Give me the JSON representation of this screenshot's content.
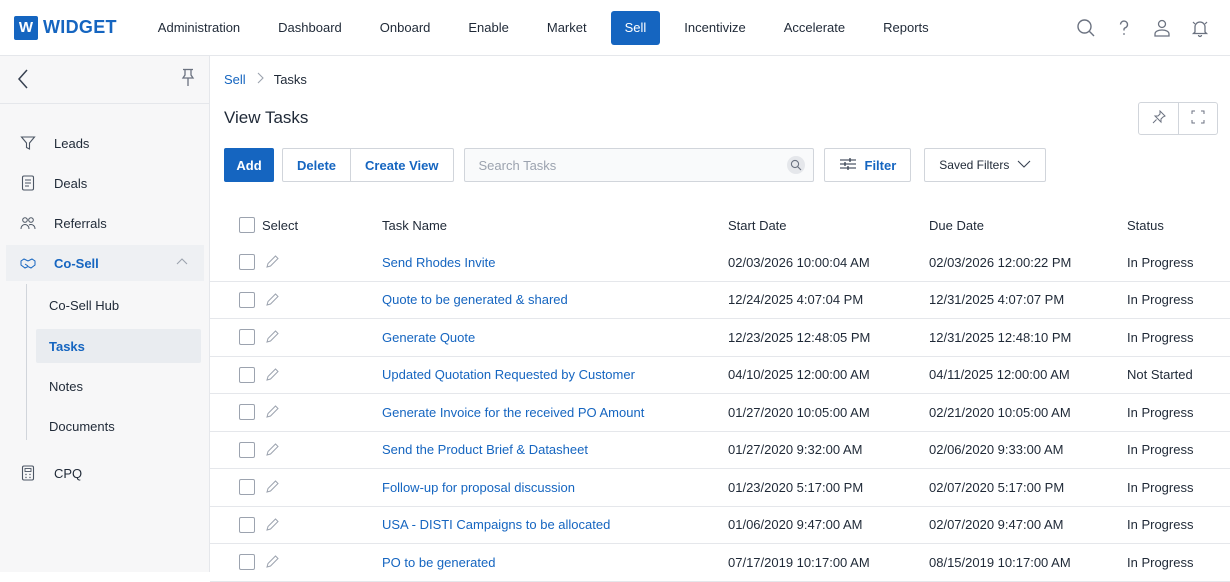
{
  "brand": {
    "logo_letter": "W",
    "name": "WIDGET",
    "color": "#1565c0"
  },
  "topnav": {
    "items": [
      {
        "label": "Administration",
        "active": false
      },
      {
        "label": "Dashboard",
        "active": false
      },
      {
        "label": "Onboard",
        "active": false
      },
      {
        "label": "Enable",
        "active": false
      },
      {
        "label": "Market",
        "active": false
      },
      {
        "label": "Sell",
        "active": true
      },
      {
        "label": "Incentivize",
        "active": false
      },
      {
        "label": "Accelerate",
        "active": false
      },
      {
        "label": "Reports",
        "active": false
      }
    ],
    "icons": [
      "search-icon",
      "help-icon",
      "user-icon",
      "bell-icon"
    ]
  },
  "sidebar": {
    "items": [
      {
        "label": "Leads",
        "icon": "funnel-icon"
      },
      {
        "label": "Deals",
        "icon": "document-icon"
      },
      {
        "label": "Referrals",
        "icon": "people-icon"
      },
      {
        "label": "Co-Sell",
        "icon": "handshake-icon",
        "active": true,
        "expanded": true
      },
      {
        "label": "CPQ",
        "icon": "calculator-icon"
      }
    ],
    "subitems": [
      {
        "label": "Co-Sell Hub",
        "active": false
      },
      {
        "label": "Tasks",
        "active": true
      },
      {
        "label": "Notes",
        "active": false
      },
      {
        "label": "Documents",
        "active": false
      }
    ]
  },
  "breadcrumb": {
    "parent": "Sell",
    "current": "Tasks"
  },
  "page": {
    "title": "View Tasks"
  },
  "toolbar": {
    "add_label": "Add",
    "delete_label": "Delete",
    "create_view_label": "Create View",
    "search_placeholder": "Search Tasks",
    "filter_label": "Filter",
    "saved_filters_label": "Saved Filters"
  },
  "table": {
    "columns": {
      "select": "Select",
      "name": "Task Name",
      "start": "Start Date",
      "due": "Due Date",
      "status": "Status"
    },
    "rows": [
      {
        "name": "Send Rhodes Invite",
        "start": "02/03/2026 10:00:04 AM",
        "due": "02/03/2026 12:00:22 PM",
        "status": "In Progress"
      },
      {
        "name": "Quote to be generated & shared",
        "start": "12/24/2025 4:07:04 PM",
        "due": "12/31/2025 4:07:07 PM",
        "status": "In Progress"
      },
      {
        "name": "Generate Quote",
        "start": "12/23/2025 12:48:05 PM",
        "due": "12/31/2025 12:48:10 PM",
        "status": "In Progress"
      },
      {
        "name": "Updated Quotation Requested by Customer",
        "start": "04/10/2025 12:00:00 AM",
        "due": "04/11/2025 12:00:00 AM",
        "status": "Not Started"
      },
      {
        "name": "Generate Invoice for the received PO Amount",
        "start": "01/27/2020 10:05:00 AM",
        "due": "02/21/2020 10:05:00 AM",
        "status": "In Progress"
      },
      {
        "name": "Send the Product Brief & Datasheet",
        "start": "01/27/2020 9:32:00 AM",
        "due": "02/06/2020 9:33:00 AM",
        "status": "In Progress"
      },
      {
        "name": "Follow-up for proposal discussion",
        "start": "01/23/2020 5:17:00 PM",
        "due": "02/07/2020 5:17:00 PM",
        "status": "In Progress"
      },
      {
        "name": "USA - DISTI Campaigns to be allocated",
        "start": "01/06/2020 9:47:00 AM",
        "due": "02/07/2020 9:47:00 AM",
        "status": "In Progress"
      },
      {
        "name": "PO to be generated",
        "start": "07/17/2019 10:17:00 AM",
        "due": "08/15/2019 10:17:00 AM",
        "status": "In Progress"
      }
    ]
  }
}
